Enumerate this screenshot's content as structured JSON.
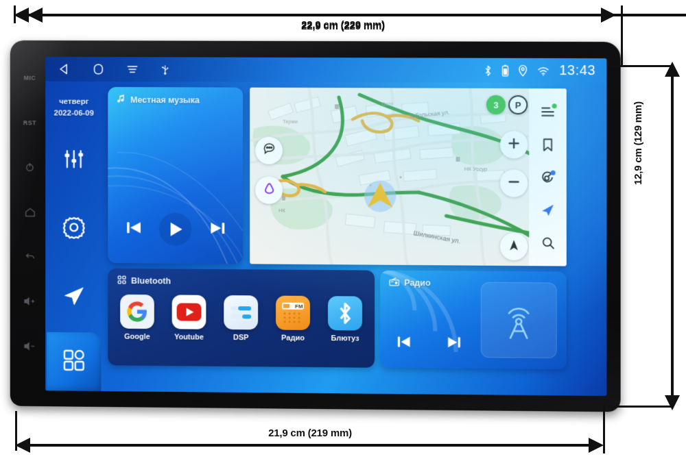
{
  "annotations": {
    "top_width": "22,9 cm (229 mm)",
    "bottom_width": "21,9 cm (219 mm)",
    "right_height": "12,9 cm (129 mm)"
  },
  "bezel": {
    "items": [
      {
        "label": "MIC",
        "icon": "microphone-label"
      },
      {
        "label": "RST",
        "icon": "reset-label"
      },
      {
        "label": "",
        "icon": "power-icon"
      },
      {
        "label": "",
        "icon": "home-icon"
      },
      {
        "label": "",
        "icon": "back-icon"
      },
      {
        "label": "",
        "icon": "volume-up-icon"
      },
      {
        "label": "",
        "icon": "volume-down-icon"
      }
    ]
  },
  "statusbar": {
    "nav": [
      {
        "icon": "back-triangle-icon",
        "name": "back-button"
      },
      {
        "icon": "home-square-icon",
        "name": "home-button"
      },
      {
        "icon": "recents-lines-icon",
        "name": "recents-button"
      },
      {
        "icon": "usb-icon",
        "name": "usb-indicator"
      }
    ],
    "indicators": [
      {
        "icon": "bluetooth-icon"
      },
      {
        "icon": "battery-icon"
      },
      {
        "icon": "location-icon"
      },
      {
        "icon": "wifi-icon"
      }
    ],
    "time": "13:43"
  },
  "rail": {
    "day": "четверг",
    "date": "2022-06-09",
    "buttons": [
      {
        "icon": "equalizer-icon",
        "name": "equalizer-button"
      },
      {
        "icon": "gear-icon",
        "name": "settings-button"
      },
      {
        "icon": "navigation-arrow-icon",
        "name": "navigation-button"
      }
    ],
    "launcher": {
      "icon": "apps-grid-icon",
      "name": "all-apps-button"
    }
  },
  "music_card": {
    "title": "Местная музыка",
    "title_icon": "music-note-icon",
    "controls": [
      {
        "icon": "previous-track-icon",
        "name": "previous-button"
      },
      {
        "icon": "play-icon",
        "name": "play-button"
      },
      {
        "icon": "next-track-icon",
        "name": "next-button"
      }
    ]
  },
  "map_card": {
    "traffic_badge": "3",
    "parking_badge": "P",
    "labels": [
      "Тобольская ул.",
      "Шилкинская ул.",
      "НК Уссур",
      "Терми",
      "Охот",
      "НК"
    ],
    "left_buttons": [
      {
        "icon": "chat-bubble-icon",
        "name": "chat-button"
      },
      {
        "icon": "alice-triangle-icon",
        "name": "alice-assistant-button"
      }
    ],
    "zoom_buttons": [
      {
        "icon": "plus-icon",
        "name": "zoom-in-button"
      },
      {
        "icon": "minus-icon",
        "name": "zoom-out-button"
      },
      {
        "icon": "compass-north-icon",
        "name": "compass-button"
      }
    ],
    "rail_buttons": [
      {
        "icon": "menu-lines-icon",
        "name": "map-menu-button",
        "dot": "#3ec13e"
      },
      {
        "icon": "bookmark-icon",
        "name": "bookmarks-button",
        "dot": ""
      },
      {
        "icon": "radar-icon",
        "name": "radar-button",
        "dot": "#2f6df2"
      },
      {
        "icon": "navigate-arrow-icon",
        "name": "route-button",
        "dot": ""
      },
      {
        "icon": "search-icon",
        "name": "map-search-button",
        "dot": ""
      }
    ]
  },
  "apps_card": {
    "title": "Bluetooth",
    "title_icon": "bluetooth-apps-icon",
    "apps": [
      {
        "label": "Google",
        "icon": "google-icon"
      },
      {
        "label": "Youtube",
        "icon": "youtube-icon"
      },
      {
        "label": "DSP",
        "icon": "dsp-equalizer-icon"
      },
      {
        "label": "Радио",
        "icon": "radio-fm-icon"
      },
      {
        "label": "Блютуз",
        "icon": "bluetooth-icon"
      }
    ]
  },
  "radio_card": {
    "title": "Радио",
    "title_icon": "radio-device-icon",
    "controls": [
      {
        "icon": "previous-station-icon",
        "name": "previous-station-button"
      },
      {
        "icon": "next-station-icon",
        "name": "next-station-button"
      }
    ],
    "art_icon": "broadcast-tower-icon"
  },
  "colors": {
    "screen_blue": "#1168d8",
    "accent_cyan": "#37c6f5",
    "deep_navy": "#0d2868",
    "traffic_green": "#3ec13e",
    "radio_orange": "#f59322"
  }
}
